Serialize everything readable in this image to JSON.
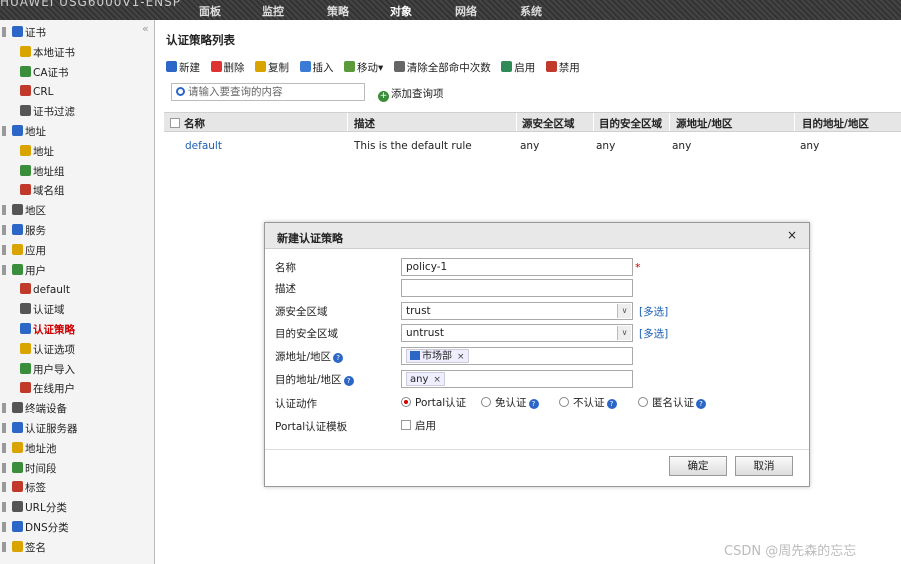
{
  "topbar": {
    "brand": "HUAWEI  USG6000V1-ENSP",
    "nav": [
      "面板",
      "监控",
      "策略",
      "对象",
      "网络",
      "系统"
    ]
  },
  "sidebar": {
    "collapse": "«",
    "items": [
      {
        "label": "证书",
        "level": 0
      },
      {
        "label": "本地证书",
        "level": 1
      },
      {
        "label": "CA证书",
        "level": 1
      },
      {
        "label": "CRL",
        "level": 1
      },
      {
        "label": "证书过滤",
        "level": 1
      },
      {
        "label": "地址",
        "level": 0
      },
      {
        "label": "地址",
        "level": 1
      },
      {
        "label": "地址组",
        "level": 1
      },
      {
        "label": "域名组",
        "level": 1
      },
      {
        "label": "地区",
        "level": 0
      },
      {
        "label": "服务",
        "level": 0
      },
      {
        "label": "应用",
        "level": 0
      },
      {
        "label": "用户",
        "level": 0
      },
      {
        "label": "default",
        "level": 1
      },
      {
        "label": "认证域",
        "level": 1
      },
      {
        "label": "认证策略",
        "level": 1,
        "active": true
      },
      {
        "label": "认证选项",
        "level": 1
      },
      {
        "label": "用户导入",
        "level": 1
      },
      {
        "label": "在线用户",
        "level": 1
      },
      {
        "label": "终端设备",
        "level": 0
      },
      {
        "label": "认证服务器",
        "level": 0
      },
      {
        "label": "地址池",
        "level": 0
      },
      {
        "label": "时间段",
        "level": 0
      },
      {
        "label": "标签",
        "level": 0
      },
      {
        "label": "URL分类",
        "level": 0
      },
      {
        "label": "DNS分类",
        "level": 0
      },
      {
        "label": "签名",
        "level": 0
      }
    ]
  },
  "main": {
    "title": "认证策略列表",
    "toolbar": [
      "新建",
      "删除",
      "复制",
      "插入",
      "移动▾",
      "清除全部命中次数",
      "启用",
      "禁用"
    ],
    "search_placeholder": "请输入要查询的内容",
    "add_query": "添加查询项",
    "columns": [
      "名称",
      "描述",
      "源安全区域",
      "目的安全区域",
      "源地址/地区",
      "目的地址/地区"
    ],
    "rows": [
      {
        "name": "default",
        "desc": "This is the default rule",
        "src_zone": "any",
        "dst_zone": "any",
        "src_addr": "any",
        "dst_addr": "any"
      }
    ]
  },
  "modal": {
    "title": "新建认证策略",
    "close": "×",
    "labels": {
      "name": "名称",
      "desc": "描述",
      "src_zone": "源安全区域",
      "dst_zone": "目的安全区域",
      "src_addr": "源地址/地区",
      "dst_addr": "目的地址/地区",
      "action": "认证动作",
      "portal_tpl": "Portal认证模板"
    },
    "values": {
      "name": "policy-1",
      "desc": "",
      "src_zone": "trust",
      "dst_zone": "untrust",
      "src_addr_tag": "市场部",
      "dst_addr_tag": "any"
    },
    "required_mark": "*",
    "multi_select": "[多选]",
    "tag_remove": "×",
    "dropdown_glyph": "∨",
    "help_glyph": "?",
    "actions": [
      {
        "label": "Portal认证",
        "selected": true
      },
      {
        "label": "免认证",
        "selected": false
      },
      {
        "label": "不认证",
        "selected": false
      },
      {
        "label": "匿名认证",
        "selected": false
      }
    ],
    "enable_label": "启用",
    "ok": "确定",
    "cancel": "取消"
  },
  "watermark": "CSDN @周先森的忘忘",
  "colors": {
    "active": "#cc0000",
    "link": "#1a5fb4",
    "help": "#2c66c7"
  }
}
